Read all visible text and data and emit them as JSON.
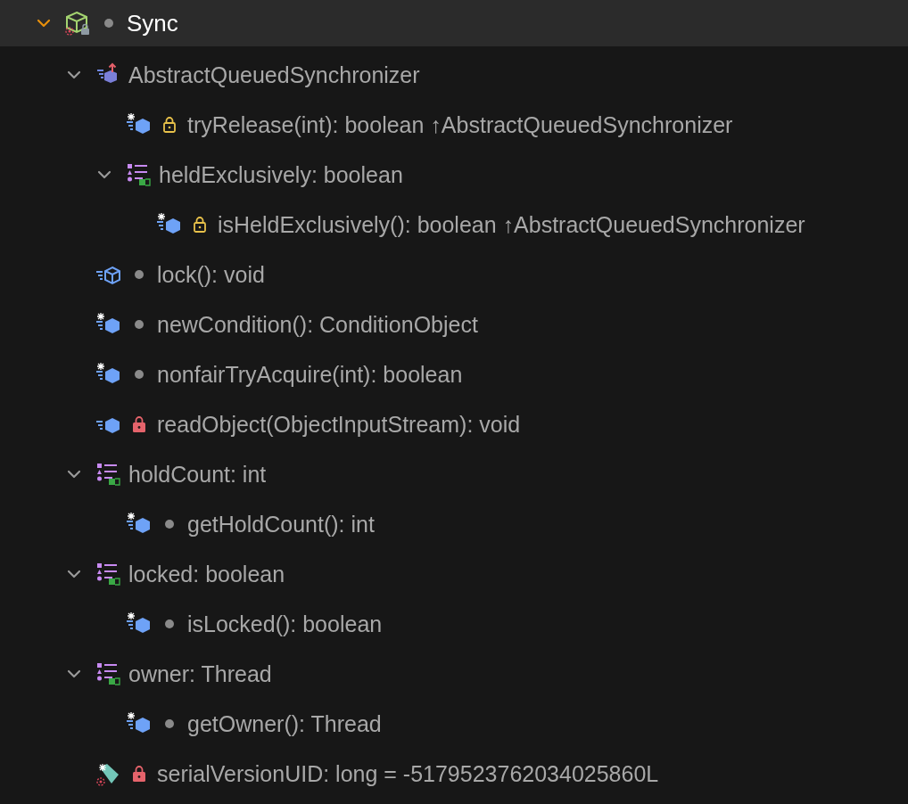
{
  "tree": [
    {
      "kind": "class",
      "access": {
        "kind": "package"
      },
      "text": "Sync",
      "selected": true,
      "expanded": true,
      "children": [
        {
          "kind": "superclass",
          "text": "AbstractQueuedSynchronizer",
          "selected": false,
          "expanded": true,
          "children": [
            {
              "kind": "method",
              "access": {
                "kind": "protected"
              },
              "text": "tryRelease(int): boolean ↑AbstractQueuedSynchronizer",
              "selected": false
            },
            {
              "kind": "property",
              "text": "heldExclusively: boolean",
              "selected": false,
              "expanded": true,
              "children": [
                {
                  "kind": "method",
                  "access": {
                    "kind": "protected"
                  },
                  "text": "isHeldExclusively(): boolean ↑AbstractQueuedSynchronizer",
                  "selected": false
                }
              ]
            }
          ]
        },
        {
          "kind": "abstract",
          "access": {
            "kind": "package"
          },
          "text": "lock(): void",
          "selected": false
        },
        {
          "kind": "method",
          "access": {
            "kind": "package"
          },
          "text": "newCondition(): ConditionObject",
          "selected": false
        },
        {
          "kind": "method",
          "access": {
            "kind": "package"
          },
          "text": "nonfairTryAcquire(int): boolean",
          "selected": false
        },
        {
          "kind": "plain",
          "access": {
            "kind": "private"
          },
          "text": "readObject(ObjectInputStream): void",
          "selected": false
        },
        {
          "kind": "property",
          "text": "holdCount: int",
          "selected": false,
          "expanded": true,
          "children": [
            {
              "kind": "method",
              "access": {
                "kind": "package"
              },
              "text": "getHoldCount(): int",
              "selected": false
            }
          ]
        },
        {
          "kind": "property",
          "text": "locked: boolean",
          "selected": false,
          "expanded": true,
          "children": [
            {
              "kind": "method",
              "access": {
                "kind": "package"
              },
              "text": "isLocked(): boolean",
              "selected": false
            }
          ]
        },
        {
          "kind": "property",
          "text": "owner: Thread",
          "selected": false,
          "expanded": true,
          "children": [
            {
              "kind": "method",
              "access": {
                "kind": "package"
              },
              "text": "getOwner(): Thread",
              "selected": false
            }
          ]
        },
        {
          "kind": "field",
          "access": {
            "kind": "private"
          },
          "text": "serialVersionUID: long = -5179523762034025860L",
          "selected": false
        }
      ]
    }
  ]
}
